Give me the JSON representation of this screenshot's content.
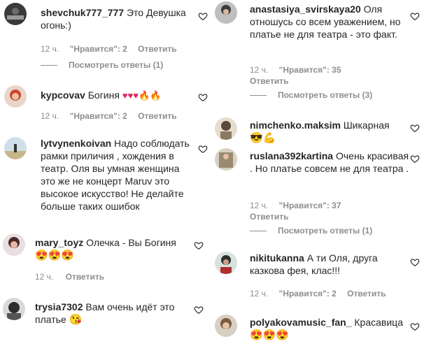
{
  "left": [
    {
      "user": "shevchuk777_777",
      "text": "Это Девушка огонь:)",
      "time": "12 ч.",
      "likes": "\"Нравится\": 2",
      "reply": "Ответить",
      "view_replies": "Посмотреть ответы (1)"
    },
    {
      "user": "kypcovav",
      "text": "Богиня",
      "emoji": "♥♥♥🔥🔥",
      "time": "12 ч.",
      "likes": "\"Нравится\": 2",
      "reply": "Ответить"
    },
    {
      "user": "lytvynenkoivan",
      "text": "Надо соблюдать рамки приличия , хождения в театр. Оля вы умная женщина это же не концерт Maruv это высокое искусство! Не делайте больше таких ошибок"
    },
    {
      "user": "mary_toyz",
      "text": "Олечка - Вы Богиня",
      "emoji": "😍😍😍",
      "time": "12 ч.",
      "reply": "Ответить"
    },
    {
      "user": "trysia7302",
      "text": "Вам очень идёт это платье",
      "emoji": "😘"
    }
  ],
  "right": [
    {
      "user": "anastasiya_svirskaya20",
      "text": "Оля отношусь со всем уважением, но платье не для театра - это факт.",
      "time": "12 ч.",
      "likes": "\"Нравится\": 35",
      "reply": "Ответить",
      "view_replies": "Посмотреть ответы (3)"
    },
    {
      "user": "nimchenko.maksim",
      "text": "Шикарная",
      "emoji": "😎💪"
    },
    {
      "user": "ruslana392kartina",
      "text": "Очень красивая . Но платье совсем не для театра .",
      "time": "12 ч.",
      "likes": "\"Нравится\": 37",
      "reply": "Ответить",
      "view_replies": "Посмотреть ответы (1)"
    },
    {
      "user": "nikitukanna",
      "text": "А ти Оля, друга казкова фея, клас!!!",
      "time": "12 ч.",
      "likes": "\"Нравится\": 2",
      "reply": "Ответить"
    },
    {
      "user": "polyakovamusic_fan_",
      "text": "Красавица",
      "emoji": "😍😍😍"
    }
  ],
  "colors": {
    "text": "#262626",
    "muted": "#8e8e8e",
    "heart_red": "#ed4956"
  }
}
